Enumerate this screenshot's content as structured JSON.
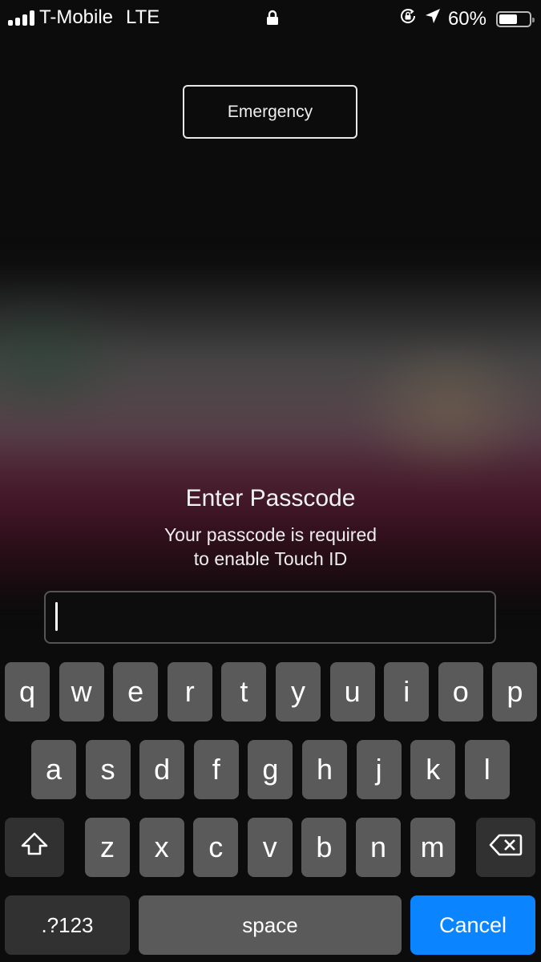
{
  "status_bar": {
    "carrier": "T-Mobile",
    "network": "LTE",
    "battery_percent_label": "60%",
    "battery_level": 0.6,
    "icons": [
      "signal-bars-icon",
      "lock-icon",
      "orientation-lock-icon",
      "location-arrow-icon",
      "battery-icon"
    ]
  },
  "emergency_button": {
    "label": "Emergency"
  },
  "prompt": {
    "title": "Enter Passcode",
    "subtitle_line1": "Your passcode is required",
    "subtitle_line2": "to enable Touch ID"
  },
  "passcode_field": {
    "value": ""
  },
  "keyboard": {
    "row1": [
      "q",
      "w",
      "e",
      "r",
      "t",
      "y",
      "u",
      "i",
      "o",
      "p"
    ],
    "row2": [
      "a",
      "s",
      "d",
      "f",
      "g",
      "h",
      "j",
      "k",
      "l"
    ],
    "row3": [
      "z",
      "x",
      "c",
      "v",
      "b",
      "n",
      "m"
    ],
    "shift_icon": "shift-icon",
    "delete_icon": "delete-backspace-icon",
    "numbers_label": ".?123",
    "space_label": "space",
    "cancel_label": "Cancel"
  },
  "colors": {
    "accent": "#0a84ff",
    "key": "#5a5a5a",
    "key_dark": "#313131",
    "background": "#0c0c0c"
  }
}
